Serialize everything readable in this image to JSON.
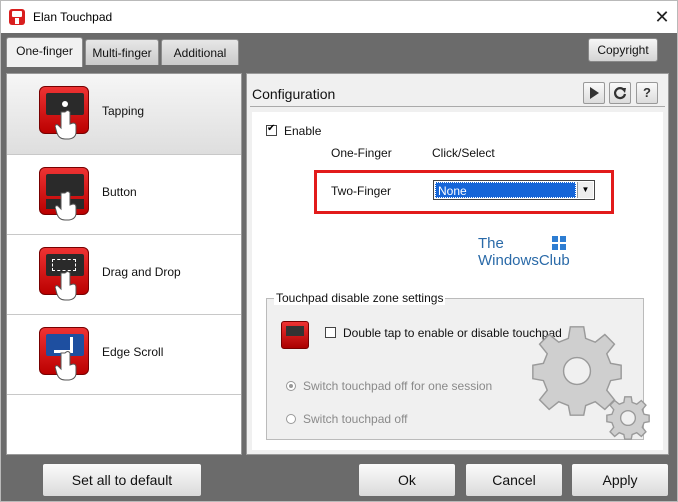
{
  "window": {
    "title": "Elan Touchpad",
    "close": "✕"
  },
  "tabs": [
    {
      "label": "One-finger",
      "active": true
    },
    {
      "label": "Multi-finger",
      "active": false
    },
    {
      "label": "Additional",
      "active": false
    }
  ],
  "copyright_label": "Copyright",
  "left_items": [
    {
      "label": "Tapping",
      "icon": "tapping-icon",
      "selected": true
    },
    {
      "label": "Button",
      "icon": "button-icon",
      "selected": false
    },
    {
      "label": "Drag and Drop",
      "icon": "drag-drop-icon",
      "selected": false
    },
    {
      "label": "Edge Scroll",
      "icon": "edge-scroll-icon",
      "selected": false
    }
  ],
  "config": {
    "heading": "Configuration",
    "enable_label": "Enable",
    "enable_checked": true,
    "one_finger_label": "One-Finger",
    "one_finger_value": "Click/Select",
    "two_finger_label": "Two-Finger",
    "two_finger_value": "None"
  },
  "watermark": {
    "line1": "The",
    "line2": "WindowsClub"
  },
  "disable_zone": {
    "title": "Touchpad disable zone settings",
    "double_tap_label": "Double tap to enable or disable touchpad",
    "double_tap_checked": false,
    "opt_session": "Switch touchpad off for one session",
    "opt_off": "Switch touchpad off",
    "selected_option": "session"
  },
  "buttons": {
    "set_default": "Set all to default",
    "ok": "Ok",
    "cancel": "Cancel",
    "apply": "Apply"
  },
  "colors": {
    "accent_red": "#e21b1b",
    "selection_blue": "#1565d8",
    "frame_grey": "#6b6b6b"
  }
}
